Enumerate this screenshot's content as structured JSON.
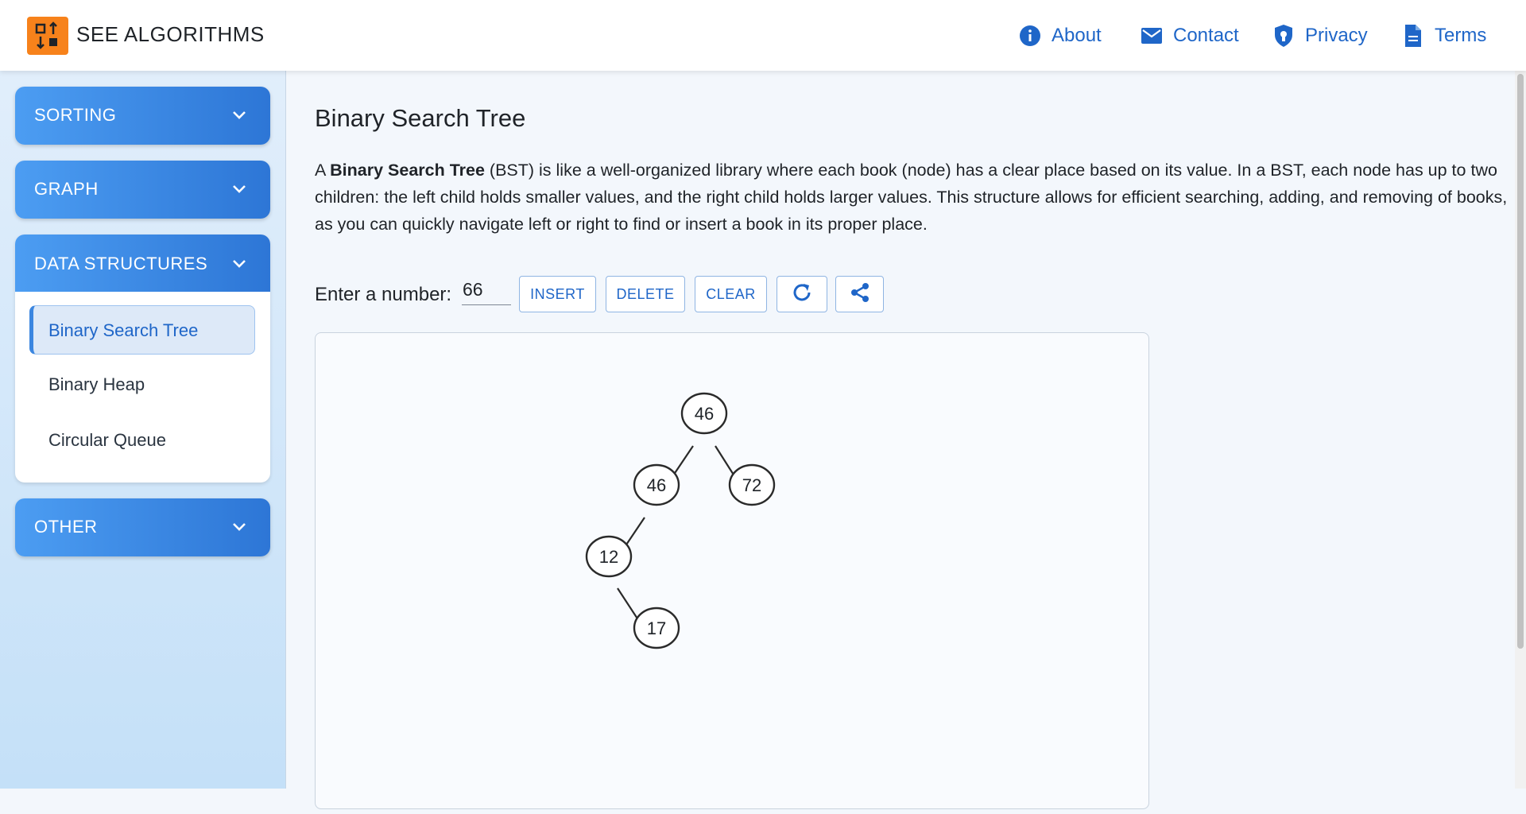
{
  "brand": {
    "name": "SEE ALGORITHMS"
  },
  "header_nav": [
    {
      "label": "About",
      "icon": "info-icon"
    },
    {
      "label": "Contact",
      "icon": "mail-icon"
    },
    {
      "label": "Privacy",
      "icon": "shield-icon"
    },
    {
      "label": "Terms",
      "icon": "document-icon"
    }
  ],
  "sidebar": {
    "sections": [
      {
        "label": "SORTING",
        "expanded": false
      },
      {
        "label": "GRAPH",
        "expanded": false
      },
      {
        "label": "DATA STRUCTURES",
        "expanded": true,
        "items": [
          {
            "label": "Binary Search Tree",
            "active": true
          },
          {
            "label": "Binary Heap",
            "active": false
          },
          {
            "label": "Circular Queue",
            "active": false
          }
        ]
      },
      {
        "label": "OTHER",
        "expanded": false
      }
    ]
  },
  "page": {
    "title": "Binary Search Tree",
    "description": {
      "prefix": "A ",
      "bold": "Binary Search Tree",
      "rest": " (BST) is like a well-organized library where each book (node) has a clear place based on its value. In a BST, each node has up to two children: the left child holds smaller values, and the right child holds larger values. This structure allows for efficient searching, adding, and removing of books, as you can quickly navigate left or right to find or insert a book in its proper place."
    }
  },
  "controls": {
    "enter_label": "Enter a number:",
    "input_value": "66",
    "insert_label": "INSERT",
    "delete_label": "DELETE",
    "clear_label": "CLEAR",
    "refresh_icon": "refresh-icon",
    "share_icon": "share-icon"
  },
  "tree": {
    "root": {
      "value": "46",
      "left": {
        "value": "46",
        "left": {
          "value": "12",
          "right": {
            "value": "17"
          }
        }
      },
      "right": {
        "value": "72"
      }
    }
  },
  "colors": {
    "accent": "#1f66c8",
    "logo": "#f7821b",
    "sidebar_button": "#3a8ae6"
  }
}
